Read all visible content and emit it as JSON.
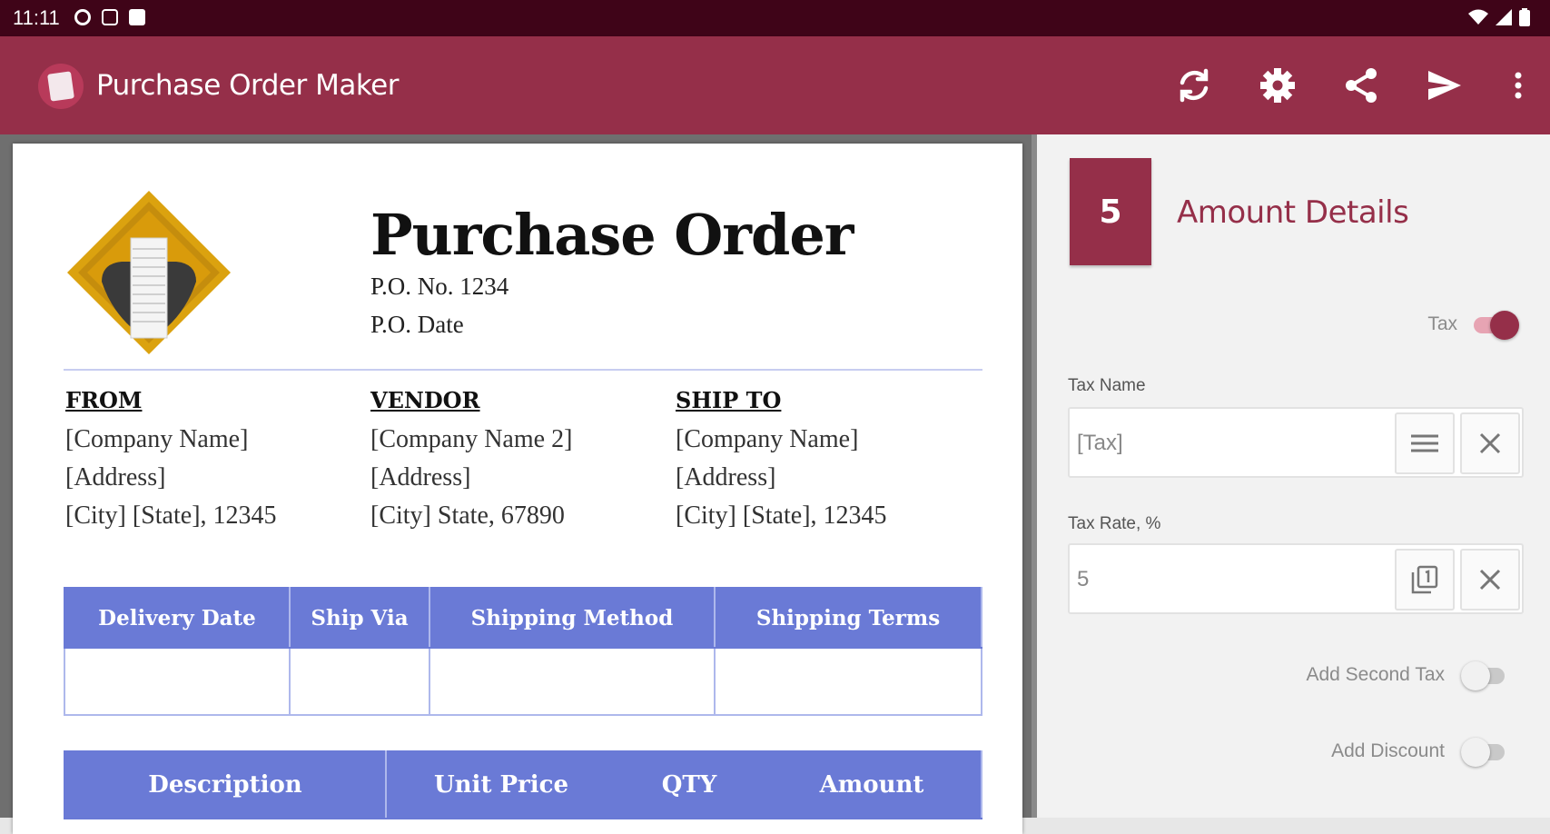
{
  "status_bar": {
    "time": "11:11"
  },
  "app_bar": {
    "title": "Purchase Order Maker",
    "actions": [
      "refresh-icon",
      "settings-gear-icon",
      "share-icon",
      "send-icon",
      "more-vert-icon"
    ]
  },
  "document": {
    "title": "Purchase Order",
    "po_number": "P.O. No. 1234",
    "po_date": "P.O. Date",
    "from": {
      "heading": "FROM",
      "lines": [
        "[Company Name]",
        "[Address]",
        "[City] [State], 12345"
      ]
    },
    "vendor": {
      "heading": "VENDOR",
      "lines": [
        "[Company Name 2]",
        "[Address]",
        "[City] State, 67890"
      ]
    },
    "ship_to": {
      "heading": "SHIP TO",
      "lines": [
        "[Company Name]",
        "[Address]",
        "[City] [State], 12345"
      ]
    },
    "shipping_table": {
      "headers": [
        "Delivery Date",
        "Ship Via",
        "Shipping Method",
        "Shipping Terms"
      ]
    },
    "items_table": {
      "headers": [
        "Description",
        "Unit Price",
        "QTY",
        "Amount"
      ]
    },
    "accent_color": "#6a7ad6"
  },
  "panel": {
    "step": "5",
    "title": "Amount Details",
    "tax_toggle_label": "Tax",
    "tax_enabled": true,
    "tax_name_label": "Tax Name",
    "tax_name_value": "[Tax]",
    "tax_rate_label": "Tax Rate, %",
    "tax_rate_value": "5",
    "second_tax_label": "Add Second Tax",
    "second_tax_enabled": false,
    "discount_label": "Add Discount",
    "discount_enabled": false,
    "brand_color": "#952f49"
  }
}
